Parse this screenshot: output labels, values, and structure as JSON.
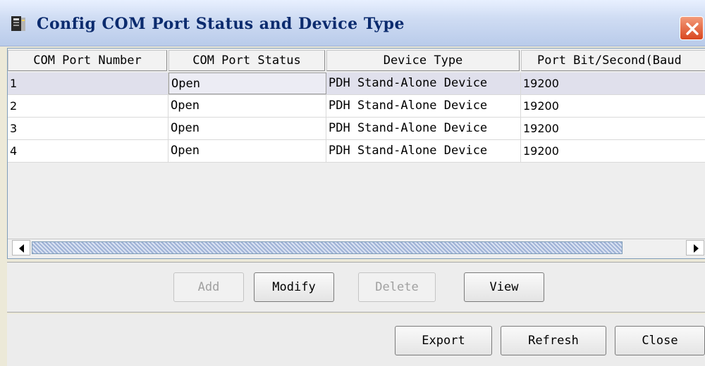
{
  "window": {
    "title": "Config COM Port Status and Device Type"
  },
  "table": {
    "columns": [
      "COM Port Number",
      "COM Port Status",
      "Device Type",
      "Port Bit/Second(Baud"
    ],
    "rows": [
      [
        "1",
        "Open",
        "PDH Stand-Alone Device",
        "19200"
      ],
      [
        "2",
        "Open",
        "PDH Stand-Alone Device",
        "19200"
      ],
      [
        "3",
        "Open",
        "PDH Stand-Alone Device",
        "19200"
      ],
      [
        "4",
        "Open",
        "PDH Stand-Alone Device",
        "19200"
      ]
    ],
    "selected_row": 1
  },
  "actions": {
    "add": "Add",
    "modify": "Modify",
    "delete": "Delete",
    "view": "View"
  },
  "footer": {
    "export": "Export",
    "refresh": "Refresh",
    "close": "Close"
  },
  "icons": {
    "window": "com-port-icon",
    "close": "close-icon",
    "scroll_left": "arrow-left-icon",
    "scroll_right": "arrow-right-icon"
  },
  "colors": {
    "title_text": "#0b2b6e",
    "close_button": "#d9461f",
    "selection": "#e0e0ec"
  }
}
